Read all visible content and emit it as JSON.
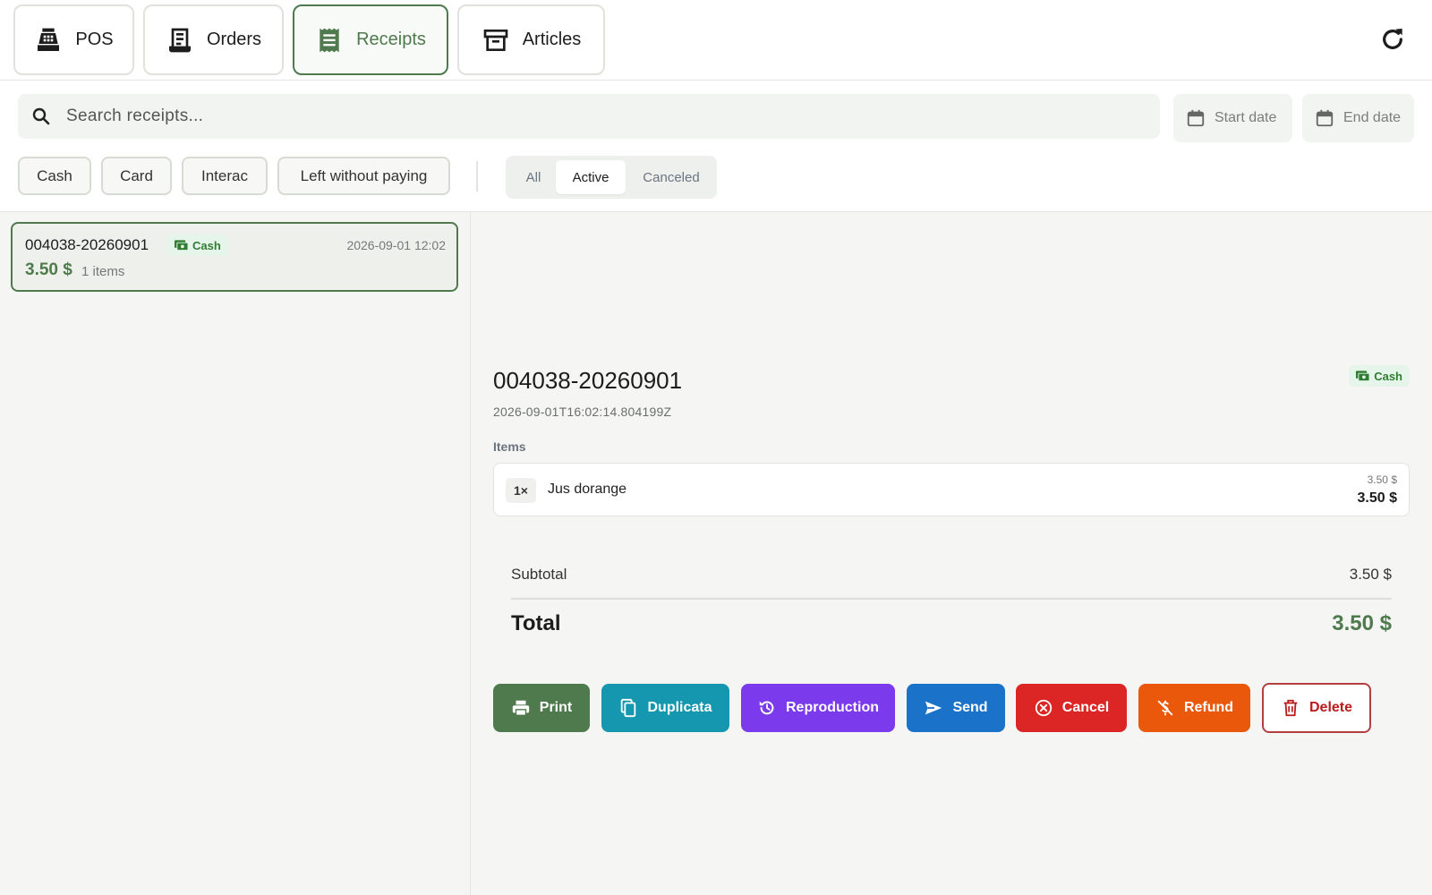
{
  "nav": {
    "tabs": [
      {
        "label": "POS",
        "icon": "cash-register-icon"
      },
      {
        "label": "Orders",
        "icon": "order-receipt-icon"
      },
      {
        "label": "Receipts",
        "icon": "receipt-long-icon",
        "active": true
      },
      {
        "label": "Articles",
        "icon": "archive-box-icon"
      }
    ],
    "refresh_icon": "refresh-icon"
  },
  "search": {
    "placeholder": "Search receipts...",
    "value": ""
  },
  "dates": {
    "start_placeholder": "Start date",
    "end_placeholder": "End date"
  },
  "payment_filters": [
    "Cash",
    "Card",
    "Interac",
    "Left without paying"
  ],
  "status_filter": {
    "options": [
      "All",
      "Active",
      "Canceled"
    ],
    "selected": "Active"
  },
  "receipts": [
    {
      "number": "004038-20260901",
      "payment": "Cash",
      "date": "2026-09-01 12:02",
      "amount": "3.50 $",
      "items_count": "1 items"
    }
  ],
  "detail": {
    "number": "004038-20260901",
    "payment": "Cash",
    "timestamp": "2026-09-01T16:02:14.804199Z",
    "items_label": "Items",
    "items": [
      {
        "qty": "1×",
        "name": "Jus dorange",
        "unit_price": "3.50 $",
        "line_total": "3.50 $"
      }
    ],
    "subtotal_label": "Subtotal",
    "subtotal": "3.50 $",
    "total_label": "Total",
    "total": "3.50 $"
  },
  "actions": {
    "print": "Print",
    "duplicata": "Duplicata",
    "reproduction": "Reproduction",
    "send": "Send",
    "cancel": "Cancel",
    "refund": "Refund",
    "delete": "Delete"
  },
  "colors": {
    "accent": "#4e7a4d",
    "duplicata": "#1597b0",
    "reproduction": "#7c3aed",
    "send": "#1a73c8",
    "cancel": "#dc2626",
    "refund": "#ea580c",
    "delete": "#b91c1c",
    "cash_badge_bg": "#e6f5e9"
  }
}
